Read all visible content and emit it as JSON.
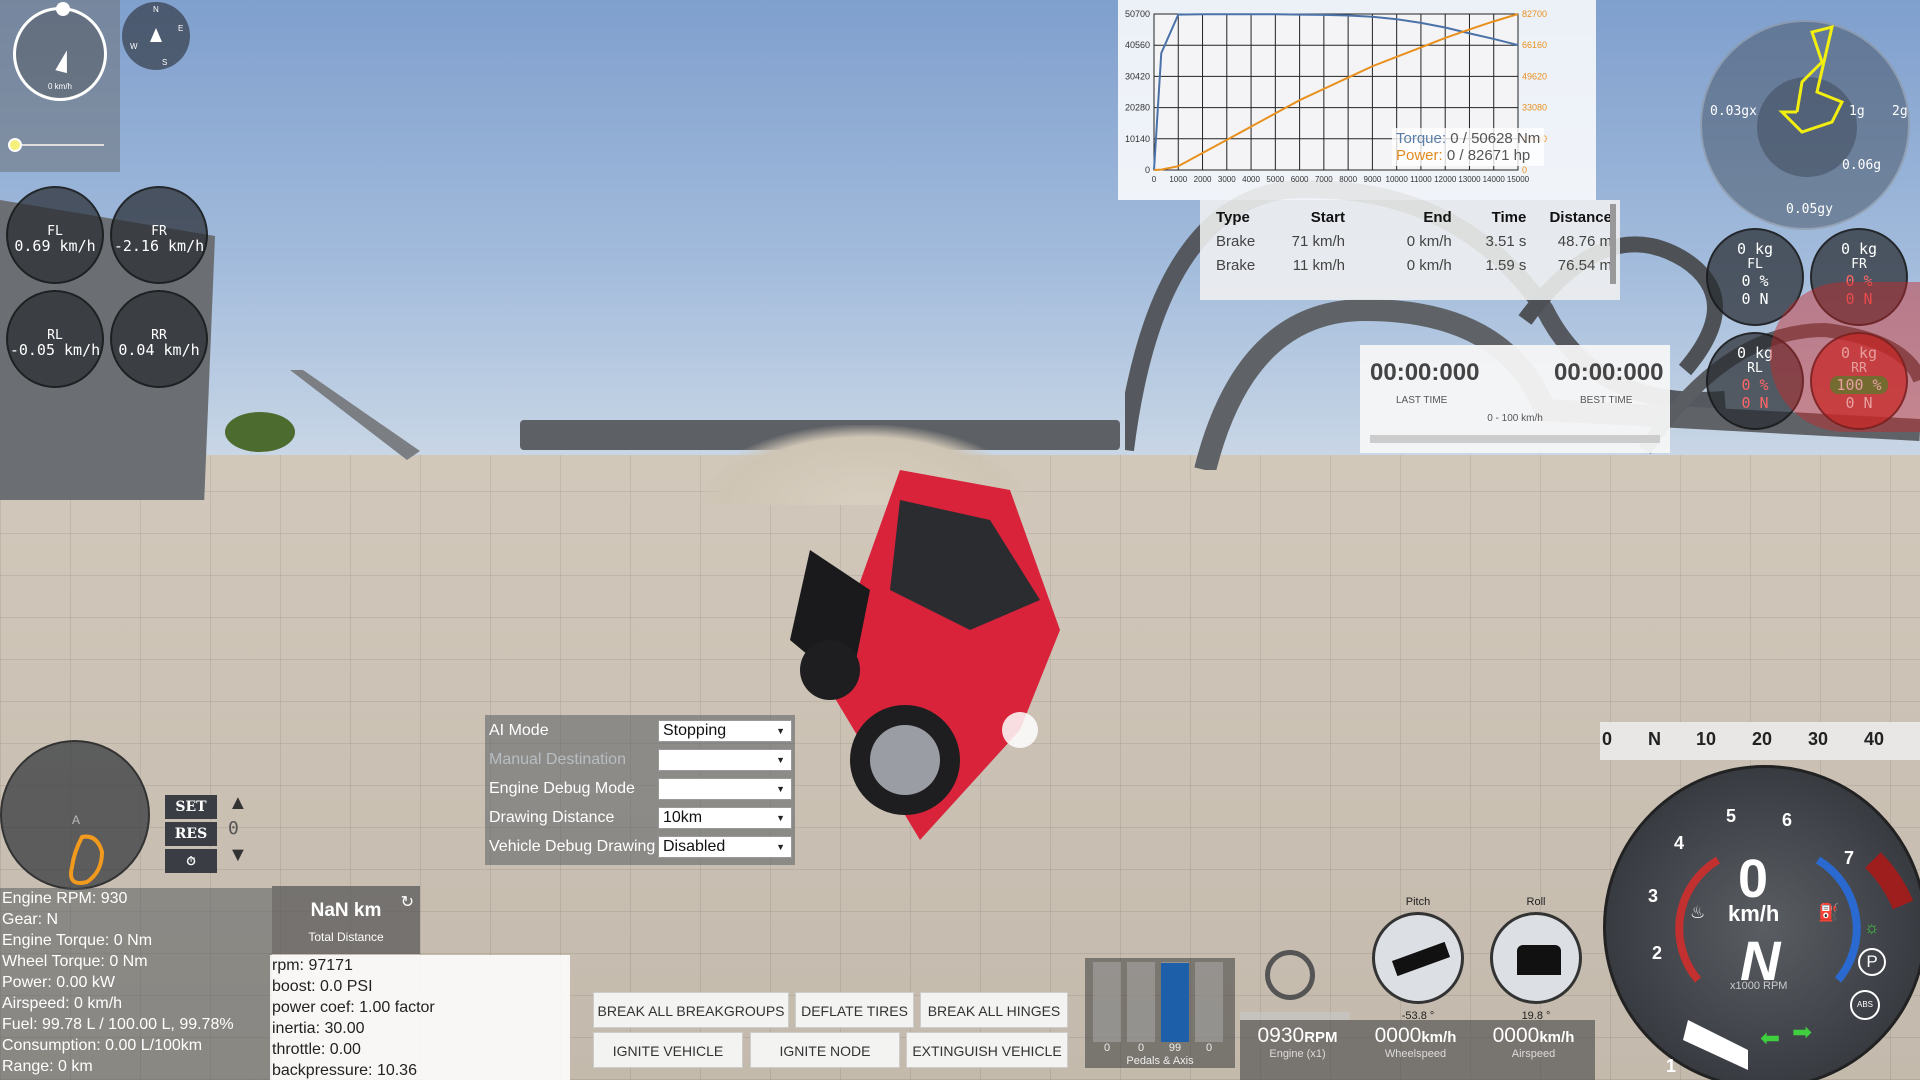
{
  "speedometer": {
    "unit_label": "0 km/h"
  },
  "compass": {
    "n": "N",
    "e": "E",
    "s": "S",
    "w": "W"
  },
  "wheel_speeds": [
    {
      "name": "FL",
      "value": "0.69 km/h"
    },
    {
      "name": "FR",
      "value": "-2.16 km/h"
    },
    {
      "name": "RL",
      "value": "-0.05 km/h"
    },
    {
      "name": "RR",
      "value": "0.04 km/h"
    }
  ],
  "torque_graph": {
    "left_ticks": [
      "50700",
      "40560",
      "30420",
      "20280",
      "10140",
      "0"
    ],
    "right_ticks": [
      "82700",
      "66160",
      "49620",
      "33080",
      "16540",
      "0"
    ],
    "x_ticks": [
      "0",
      "1000",
      "2000",
      "3000",
      "4000",
      "5000",
      "6000",
      "7000",
      "8000",
      "9000",
      "10000",
      "11000",
      "12000",
      "13000",
      "14000",
      "15000"
    ],
    "torque_label": "Torque:",
    "torque_value": "0 / 50628 Nm",
    "power_label": "Power:",
    "power_value": "0 / 82671 hp",
    "colors": {
      "torque": "#4a72a8",
      "power": "#e8901e"
    }
  },
  "chart_data": {
    "type": "line",
    "x": [
      0,
      300,
      1000,
      2000,
      3000,
      4000,
      5000,
      6000,
      7000,
      8000,
      9000,
      10000,
      11000,
      12000,
      13000,
      14000,
      15000
    ],
    "series": [
      {
        "name": "Torque",
        "axis": "left",
        "values": [
          0,
          38000,
          50500,
          50600,
          50600,
          50600,
          50600,
          50500,
          50400,
          50200,
          49800,
          49000,
          47800,
          46300,
          44400,
          42600,
          40600
        ]
      },
      {
        "name": "Power",
        "axis": "right",
        "values": [
          0,
          200,
          2000,
          9000,
          16000,
          23000,
          30000,
          37000,
          43000,
          49000,
          55000,
          60000,
          65000,
          70000,
          74500,
          78800,
          82700
        ]
      }
    ],
    "ylim_left": [
      0,
      50700
    ],
    "ylim_right": [
      0,
      82700
    ],
    "xlim": [
      0,
      15000
    ],
    "grid": true
  },
  "brake_table": {
    "headers": [
      "Type",
      "Start",
      "End",
      "Time",
      "Distance"
    ],
    "rows": [
      [
        "Brake",
        "71 km/h",
        "0 km/h",
        "3.51 s",
        "48.76 m"
      ],
      [
        "Brake",
        "11 km/h",
        "0 km/h",
        "1.59 s",
        "76.54 m"
      ]
    ]
  },
  "timer": {
    "last_time": "00:00:000",
    "last_label": "LAST TIME",
    "best_time": "00:00:000",
    "best_label": "BEST TIME",
    "mode": "0 - 100 km/h"
  },
  "gmeter": {
    "gx": "0.03gx",
    "right": "2g",
    "inner": "0.06g",
    "gy": "0.05gy",
    "ring": "1g"
  },
  "tire_loads": [
    {
      "name": "FL",
      "kg": "0 kg",
      "pct": "0 %",
      "newton": "0 N",
      "state": "normal"
    },
    {
      "name": "FR",
      "kg": "0 kg",
      "pct": "0 %",
      "newton": "0 N",
      "state": "warn"
    },
    {
      "name": "RL",
      "kg": "0 kg",
      "pct": "0 %",
      "newton": "0 N",
      "state": "warn"
    },
    {
      "name": "RR",
      "kg": "0 kg",
      "pct": "100 %",
      "newton": "0 N",
      "state": "active"
    }
  ],
  "ai_panel": {
    "rows": [
      {
        "label": "AI Mode",
        "value": "Stopping",
        "dim": false
      },
      {
        "label": "Manual Destination",
        "value": "",
        "dim": true
      },
      {
        "label": "Engine Debug Mode",
        "value": "",
        "dim": false
      },
      {
        "label": "Drawing Distance",
        "value": "10km",
        "dim": false
      },
      {
        "label": "Vehicle Debug Drawing",
        "value": "Disabled",
        "dim": false
      }
    ]
  },
  "cruise": {
    "set": "SET",
    "res": "RES",
    "speed_digit": "0"
  },
  "stats": [
    "Engine RPM: 930",
    "Gear: N",
    "Engine Torque: 0 Nm",
    "Wheel Torque: 0 Nm",
    "Power: 0.00 kW",
    "Airspeed: 0 km/h",
    "Fuel: 99.78 L / 100.00 L, 99.78%",
    "Consumption: 0.00 L/100km",
    "Range: 0 km"
  ],
  "trip": {
    "value": "NaN km",
    "label": "Total Distance"
  },
  "engine_debug": [
    "rpm: 97171",
    "boost: 0.0 PSI",
    "power coef: 1.00 factor",
    "inertia: 30.00",
    "throttle: 0.00",
    "backpressure: 10.36"
  ],
  "actions": {
    "break_all_breakgroups": "BREAK ALL BREAKGROUPS",
    "deflate_tires": "DEFLATE TIRES",
    "break_all_hinges": "BREAK ALL HINGES",
    "ignite_vehicle": "IGNITE VEHICLE",
    "ignite_node": "IGNITE NODE",
    "extinguish_vehicle": "EXTINGUISH VEHICLE"
  },
  "pedals": {
    "values": [
      "0",
      "0",
      "99",
      "0"
    ],
    "fill": [
      0,
      0,
      0.99,
      0
    ],
    "label": "Pedals & Axis"
  },
  "attitude": {
    "pitch_label": "Pitch",
    "pitch_value": "-53.8 °",
    "roll_label": "Roll",
    "roll_value": "19.8 °"
  },
  "readouts": [
    {
      "num": "0930",
      "unit": "RPM",
      "label": "Engine (x1)"
    },
    {
      "num": "0000",
      "unit": "km/h",
      "label": "Wheelspeed"
    },
    {
      "num": "0000",
      "unit": "km/h",
      "label": "Airspeed"
    }
  ],
  "tape": {
    "labels": [
      "0",
      "N",
      "10",
      "20",
      "30",
      "40"
    ]
  },
  "tacho": {
    "ticks": [
      "1",
      "2",
      "3",
      "4",
      "5",
      "6",
      "7"
    ],
    "speed": "0",
    "unit": "km/h",
    "gear": "N",
    "rpm_label": "x1000 RPM",
    "park": "P",
    "abs": "ABS"
  }
}
